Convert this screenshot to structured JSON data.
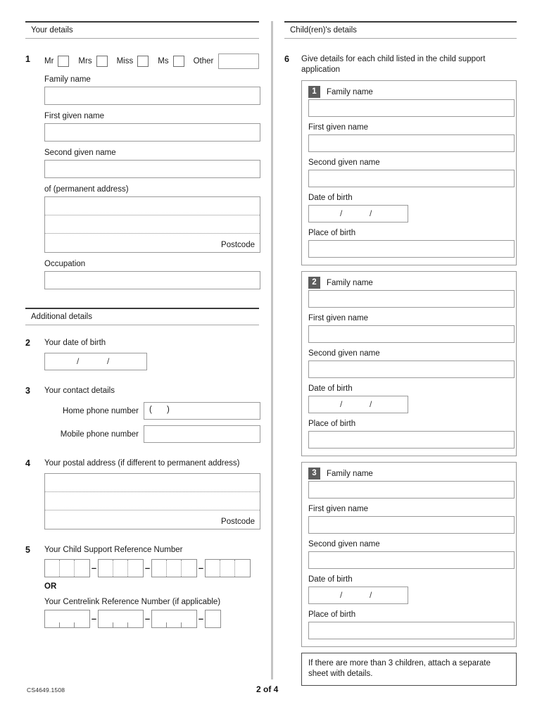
{
  "document": {
    "form_code": "CS4649.1508",
    "page_indicator": "2 of 4"
  },
  "left_column": {
    "section1": {
      "heading": "Your details",
      "q1": {
        "number": "1",
        "title_options": [
          "Mr",
          "Mrs",
          "Miss",
          "Ms"
        ],
        "other_label": "Other",
        "other_value": "",
        "fields": [
          {
            "label": "Family name",
            "value": ""
          },
          {
            "label": "First given name",
            "value": ""
          },
          {
            "label": "Second given name",
            "value": ""
          }
        ],
        "address": {
          "label": "of (permanent address)",
          "line1": "",
          "line2": "",
          "line3": "",
          "postcode_label": "Postcode",
          "postcode_value": ""
        },
        "occupation": {
          "label": "Occupation",
          "value": ""
        }
      }
    },
    "section2": {
      "heading": "Additional details",
      "q2": {
        "number": "2",
        "text": "Your date of birth",
        "separator": "/",
        "value": ""
      },
      "q3": {
        "number": "3",
        "text": "Your contact details",
        "home_phone_label": "Home phone number",
        "home_phone_prefix": "(    )",
        "home_phone_value": "",
        "mobile_phone_label": "Mobile phone number",
        "mobile_phone_value": ""
      },
      "q4": {
        "number": "4",
        "text": "Your postal address (if different to permanent address)",
        "line1": "",
        "line2": "",
        "line3": "",
        "postcode_label": "Postcode",
        "postcode_value": ""
      },
      "q5": {
        "number": "5",
        "text": "Your Child Support Reference Number",
        "dash": "–",
        "or_text": "OR",
        "centrelink_label": "Your Centrelink Reference Number (if applicable)",
        "child_support_value": "",
        "centrelink_value": ""
      }
    }
  },
  "right_column": {
    "section3": {
      "heading": "Child(ren)'s details",
      "q6": {
        "number": "6",
        "text": "Give details for each child listed in the child support application",
        "children": [
          {
            "badge": "1",
            "family_name_label": "Family name",
            "family_name_value": "",
            "first_given_name_label": "First given name",
            "first_given_name_value": "",
            "second_given_name_label": "Second given name",
            "second_given_name_value": "",
            "date_of_birth_label": "Date of birth",
            "date_of_birth_value": "",
            "place_of_birth_label": "Place of birth",
            "place_of_birth_value": ""
          },
          {
            "badge": "2",
            "family_name_label": "Family name",
            "family_name_value": "",
            "first_given_name_label": "First given name",
            "first_given_name_value": "",
            "second_given_name_label": "Second given name",
            "second_given_name_value": "",
            "date_of_birth_label": "Date of birth",
            "date_of_birth_value": "",
            "place_of_birth_label": "Place of birth",
            "place_of_birth_value": ""
          },
          {
            "badge": "3",
            "family_name_label": "Family name",
            "family_name_value": "",
            "first_given_name_label": "First given name",
            "first_given_name_value": "",
            "second_given_name_label": "Second given name",
            "second_given_name_value": "",
            "date_of_birth_label": "Date of birth",
            "date_of_birth_value": "",
            "place_of_birth_label": "Place of birth",
            "place_of_birth_value": ""
          }
        ],
        "note": "If there are more than 3 children, attach a separate sheet with details.",
        "date_separator": "/"
      }
    }
  },
  "colors": {
    "rule_dark": "#3a3a3a",
    "rule_light": "#a8a8a8",
    "box_border": "#9a9a9a",
    "badge_fill": "#5d5d5d",
    "divider": "#c4c4c4"
  }
}
